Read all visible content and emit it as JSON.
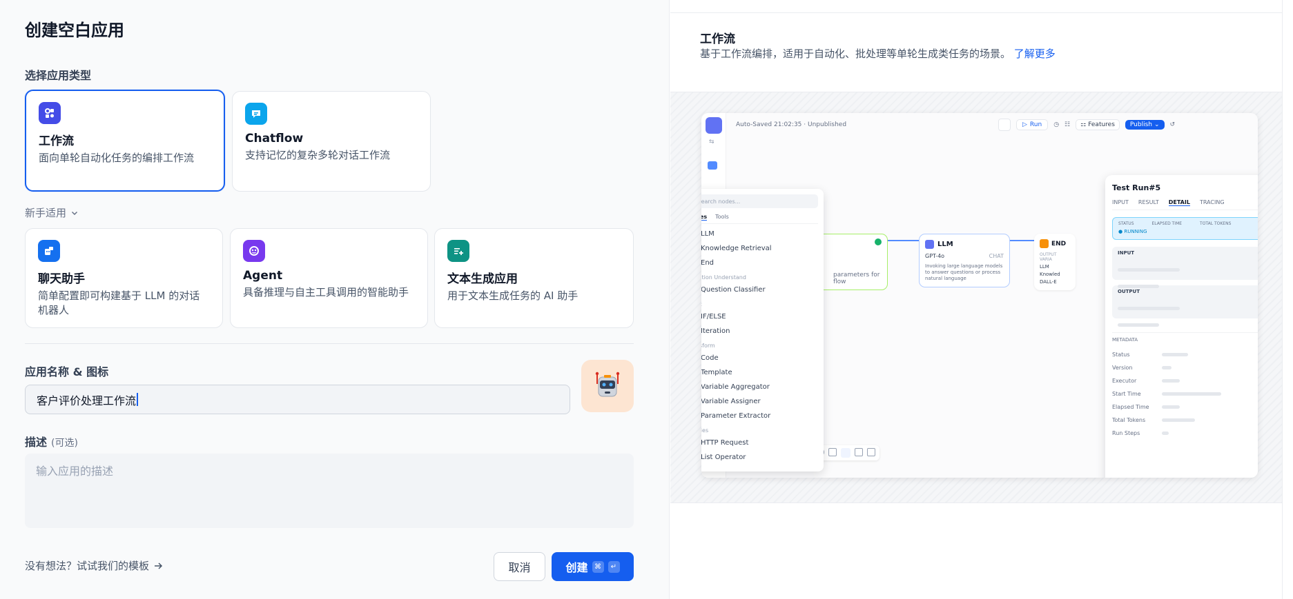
{
  "title": "创建空白应用",
  "app_type": {
    "label": "选择应用类型",
    "primary": [
      {
        "title": "工作流",
        "desc": "面向单轮自动化任务的编排工作流",
        "icon": "workflow-icon",
        "color": "#444ce7",
        "selected": true
      },
      {
        "title": "Chatflow",
        "desc": "支持记忆的复杂多轮对话工作流",
        "icon": "chatflow-icon",
        "color": "#0ba5ec",
        "selected": false
      }
    ],
    "beginner_label": "新手适用",
    "beginner": [
      {
        "title": "聊天助手",
        "desc": "简单配置即可构建基于 LLM 的对话机器人",
        "icon": "chat-assistant-icon",
        "color": "#1570ef"
      },
      {
        "title": "Agent",
        "desc": "具备推理与自主工具调用的智能助手",
        "icon": "agent-icon",
        "color": "#7839ee"
      },
      {
        "title": "文本生成应用",
        "desc": "用于文本生成任务的 AI 助手",
        "icon": "text-generation-icon",
        "color": "#0e9384"
      }
    ]
  },
  "name_section": {
    "label": "应用名称 & 图标",
    "value": "客户评价处理工作流",
    "avatar": "robot-avatar"
  },
  "desc_section": {
    "label": "描述",
    "optional": "(可选)",
    "placeholder": "输入应用的描述"
  },
  "footer": {
    "template_link": "没有想法？试试我们的模板",
    "cancel": "取消",
    "create": "创建",
    "kbd_cmd": "⌘",
    "kbd_enter": "↵"
  },
  "preview": {
    "title": "工作流",
    "desc": "基于工作流编排，适用于自动化、批处理等单轮生成类任务的场景。",
    "learn_more": "了解更多",
    "screenshot": {
      "autosaved": "Auto-Saved 21:02:35 · Unpublished",
      "run": "Run",
      "features": "Features",
      "publish": "Publish",
      "search_placeholder": "Search nodes...",
      "tabs": [
        "Nodes",
        "Tools"
      ],
      "node_groups": [
        {
          "category": "",
          "items": [
            {
              "name": "LLM",
              "color": "#6172f3"
            },
            {
              "name": "Knowledge Retrieval",
              "color": "#16b364"
            },
            {
              "name": "End",
              "color": "#f79009"
            }
          ]
        },
        {
          "category": "Question Understand",
          "items": [
            {
              "name": "Question Classifier",
              "color": "#16b364"
            }
          ]
        },
        {
          "category": "Logic",
          "items": [
            {
              "name": "IF/ELSE",
              "color": "#06aed4"
            },
            {
              "name": "Iteration",
              "color": "#06aed4"
            }
          ]
        },
        {
          "category": "Transform",
          "items": [
            {
              "name": "Code",
              "color": "#2e90fa"
            },
            {
              "name": "Template",
              "color": "#2e90fa"
            },
            {
              "name": "Variable Aggregator",
              "color": "#2e90fa"
            },
            {
              "name": "Variable Assigner",
              "color": "#2e90fa"
            },
            {
              "name": "Parameter Extractor",
              "color": "#2e90fa"
            }
          ]
        },
        {
          "category": "Utilities",
          "items": [
            {
              "name": "HTTP Request",
              "color": "#875bf7"
            },
            {
              "name": "List Operator",
              "color": "#875bf7"
            }
          ]
        }
      ],
      "llm_node": {
        "title": "LLM",
        "model": "GPT-4o",
        "mode": "CHAT",
        "desc": "Invoking large language models to answer questions or process natural language"
      },
      "start_node_desc": "parameters for flow",
      "end_node": {
        "title": "END",
        "label": "OUTPUT VARIA",
        "rows": [
          "LLM",
          "Knowled",
          "DALL-E"
        ]
      },
      "test_run": {
        "title": "Test Run#5",
        "tabs": [
          "INPUT",
          "RESULT",
          "DETAIL",
          "TRACING"
        ],
        "status_headers": [
          "STATUS",
          "ELAPSED TIME",
          "TOTAL TOKENS"
        ],
        "status": "RUNNING",
        "input": "INPUT",
        "output": "OUTPUT",
        "metadata": "METADATA",
        "meta_rows": [
          "Status",
          "Version",
          "Executor",
          "Start Time",
          "Elapsed Time",
          "Total Tokens",
          "Run Steps"
        ]
      }
    }
  }
}
